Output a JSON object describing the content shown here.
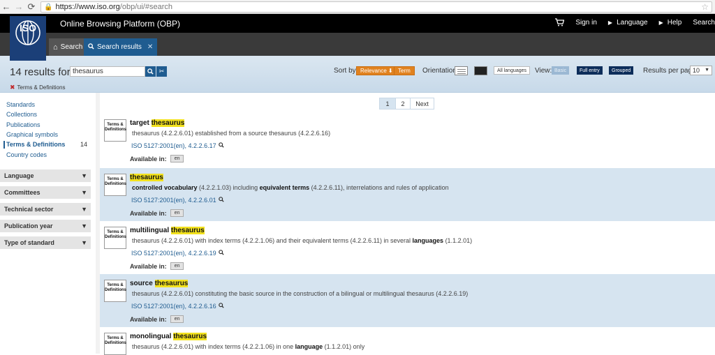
{
  "browser": {
    "url_main": "https://www.iso.org",
    "url_rest": "/obp/ui/#search"
  },
  "header": {
    "logo_text": "ISO",
    "app_title": "Online Browsing Platform (OBP)",
    "nav": {
      "sign_in": "Sign in",
      "language": "Language",
      "help": "Help",
      "search": "Search"
    }
  },
  "tabs": {
    "search": "Search",
    "results": "Search results"
  },
  "filterbar": {
    "count_text": "14 results for",
    "query": "thesaurus",
    "active_filter": "Terms & Definitions",
    "sort_label": "Sort by:",
    "sort_relevance": "Relevance",
    "sort_term": "Term",
    "orientation_label": "Orientation:",
    "all_languages": "All languages",
    "view_label": "View:",
    "view_basic": "Basic",
    "view_full": "Full entry",
    "view_grouped": "Grouped",
    "per_page_label": "Results per page:",
    "per_page_value": "10"
  },
  "sidebar": {
    "links": [
      "Standards",
      "Collections",
      "Publications",
      "Graphical symbols",
      "Terms & Definitions",
      "Country codes"
    ],
    "active_count": "14",
    "facets": [
      "Language",
      "Committees",
      "Technical sector",
      "Publication year",
      "Type of standard"
    ]
  },
  "pager": {
    "page1": "1",
    "page2": "2",
    "next": "Next"
  },
  "thumb_label": "Terms & Definitions",
  "available_label": "Available in:",
  "results": [
    {
      "term_prefix": "target ",
      "term_highlight": "thesaurus",
      "def_parts": [
        {
          "b": false,
          "t": "thesaurus (4.2.2.6.01) established from a source thesaurus (4.2.2.6.16)"
        }
      ],
      "source": "ISO 5127:2001(en), 4.2.2.6.17",
      "lang": "en"
    },
    {
      "term_prefix": "",
      "term_highlight": "thesaurus",
      "def_parts": [
        {
          "b": true,
          "t": "controlled vocabulary"
        },
        {
          "b": false,
          "t": " (4.2.2.1.03) including "
        },
        {
          "b": true,
          "t": "equivalent terms"
        },
        {
          "b": false,
          "t": " (4.2.2.6.11), interrelations and rules of application"
        }
      ],
      "source": "ISO 5127:2001(en), 4.2.2.6.01",
      "lang": "en"
    },
    {
      "term_prefix": "multilingual ",
      "term_highlight": "thesaurus",
      "def_parts": [
        {
          "b": false,
          "t": "thesaurus (4.2.2.6.01) with index terms (4.2.2.1.06) and their equivalent terms (4.2.2.6.11) in several "
        },
        {
          "b": true,
          "t": "languages"
        },
        {
          "b": false,
          "t": " (1.1.2.01)"
        }
      ],
      "source": "ISO 5127:2001(en), 4.2.2.6.19",
      "lang": "en"
    },
    {
      "term_prefix": "source ",
      "term_highlight": "thesaurus",
      "def_parts": [
        {
          "b": false,
          "t": "thesaurus (4.2.2.6.01) constituting the basic source in the construction of a bilingual or multilingual thesaurus (4.2.2.6.19)"
        }
      ],
      "source": "ISO 5127:2001(en), 4.2.2.6.16",
      "lang": "en"
    },
    {
      "term_prefix": "monolingual ",
      "term_highlight": "thesaurus",
      "def_parts": [
        {
          "b": false,
          "t": "thesaurus (4.2.2.6.01) with index terms (4.2.2.1.06) in one "
        },
        {
          "b": true,
          "t": "language"
        },
        {
          "b": false,
          "t": " (1.1.2.01) only"
        }
      ],
      "source": "",
      "lang": ""
    }
  ]
}
